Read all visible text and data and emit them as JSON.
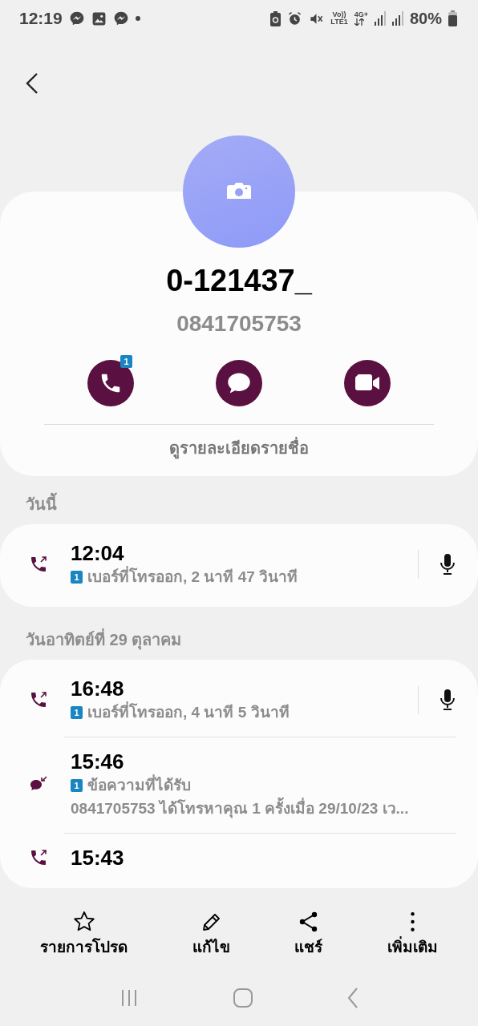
{
  "status_bar": {
    "time": "12:19",
    "volte_label": "Vo))",
    "lte_label": "LTE1",
    "network_label": "4G+",
    "battery": "80%"
  },
  "contact": {
    "name": "0-121437_",
    "number": "0841705753",
    "call_badge": "1",
    "details_link": "ดูรายละเอียดรายชื่อ"
  },
  "sections": [
    {
      "title": "วันนี้",
      "entries": [
        {
          "kind": "call",
          "time": "12:04",
          "sim": "1",
          "detail": "เบอร์ที่โทรออก, 2 นาที 47 วินาที",
          "recording": true
        }
      ]
    },
    {
      "title": "วันอาทิตย์ที่ 29 ตุลาคม",
      "entries": [
        {
          "kind": "call",
          "time": "16:48",
          "sim": "1",
          "detail": "เบอร์ที่โทรออก, 4 นาที 5 วินาที",
          "recording": true
        },
        {
          "kind": "message",
          "time": "15:46",
          "sim": "1",
          "detail": "ข้อความที่ได้รับ",
          "preview": "0841705753 ได้โทรหาคุณ 1 ครั้งเมื่อ 29/10/23 เว...",
          "recording": false
        },
        {
          "kind": "call",
          "time": "15:43",
          "recording": false
        }
      ]
    }
  ],
  "bottom_actions": [
    {
      "kind": "star",
      "label": "รายการโปรด"
    },
    {
      "kind": "edit",
      "label": "แก้ไข"
    },
    {
      "kind": "share",
      "label": "แชร์"
    },
    {
      "kind": "more",
      "label": "เพิ่มเติม"
    }
  ]
}
